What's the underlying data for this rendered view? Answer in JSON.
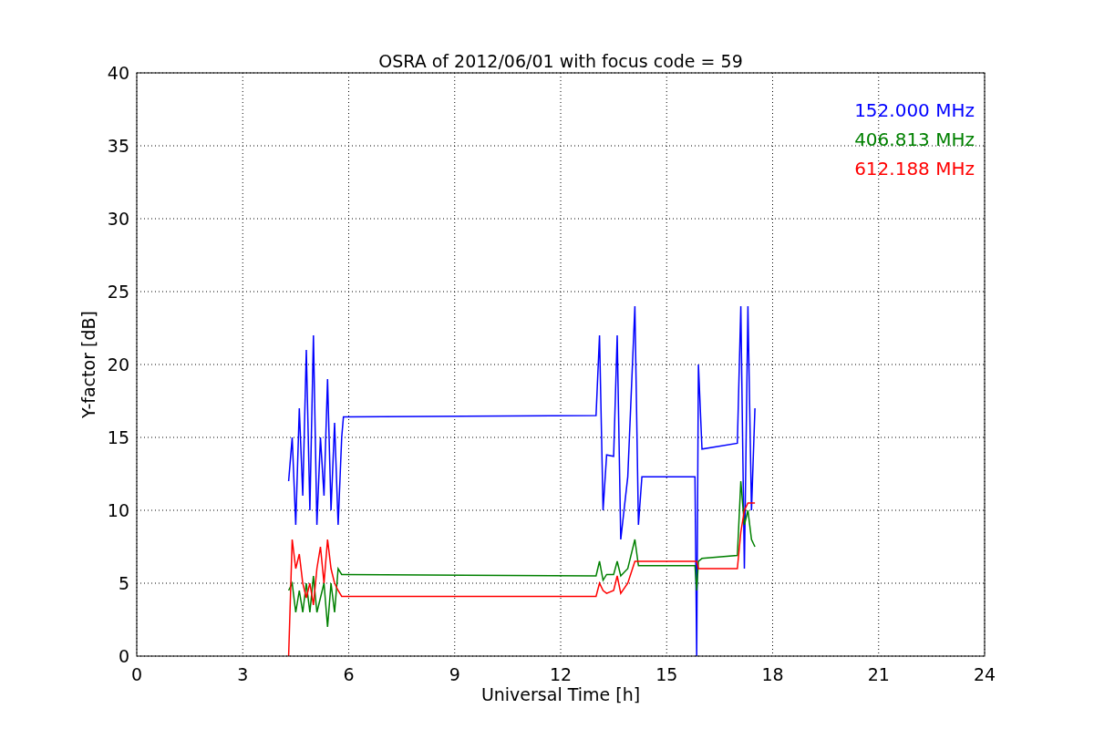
{
  "chart": {
    "chart_data": {
      "type": "line",
      "title": "OSRA of 2012/06/01 with focus code = 59",
      "xlabel": "Universal Time [h]",
      "ylabel": "Y-factor [dB]",
      "x": [
        4.3,
        4.4,
        4.5,
        4.6,
        4.7,
        4.8,
        4.9,
        5.0,
        5.1,
        5.2,
        5.3,
        5.4,
        5.5,
        5.6,
        5.7,
        5.8,
        5.85,
        13.0,
        13.1,
        13.2,
        13.3,
        13.5,
        13.6,
        13.7,
        13.9,
        14.1,
        14.2,
        14.3,
        15.8,
        15.85,
        15.9,
        16.0,
        17.0,
        17.1,
        17.2,
        17.3,
        17.4,
        17.5
      ],
      "series": [
        {
          "name": "152.000 MHz",
          "color": "#0000ff",
          "values": [
            12,
            15,
            9,
            17,
            11,
            21,
            10,
            22,
            9,
            15,
            11,
            19,
            10,
            16,
            9,
            15,
            16.4,
            16.5,
            22,
            10,
            13.8,
            13.7,
            22,
            8,
            12.3,
            24,
            9,
            12.3,
            12.3,
            0,
            20,
            14.2,
            14.6,
            24,
            6,
            24,
            10,
            17
          ]
        },
        {
          "name": "406.813 MHz",
          "color": "#008000",
          "values": [
            4.5,
            5,
            3,
            4.5,
            3,
            5,
            3,
            5.5,
            3,
            4,
            5,
            2,
            5,
            3,
            6,
            5.6,
            5.6,
            5.5,
            6.5,
            5.2,
            5.6,
            5.6,
            6.5,
            5.5,
            6,
            8,
            6.2,
            6.2,
            6.2,
            4.5,
            6.5,
            6.7,
            6.9,
            12,
            9,
            10,
            8,
            7.5
          ]
        },
        {
          "name": "612.188 MHz",
          "color": "#ff0000",
          "values": [
            0,
            8,
            6,
            7,
            5,
            4,
            5,
            3.5,
            6,
            7.5,
            5,
            8,
            6,
            5,
            4.5,
            4.1,
            4.1,
            4.1,
            5,
            4.5,
            4.3,
            4.5,
            5.5,
            4.3,
            5,
            6.5,
            6.5,
            6.5,
            6.5,
            6.5,
            6,
            6,
            6,
            8.5,
            10,
            10.5,
            10.5,
            10.5
          ]
        }
      ],
      "grid": true,
      "xlim": [
        0,
        24
      ],
      "ylim": [
        0,
        40
      ],
      "xticks": [
        0,
        3,
        6,
        9,
        12,
        15,
        18,
        21,
        24
      ],
      "yticks": [
        0,
        5,
        10,
        15,
        20,
        25,
        30,
        35,
        40
      ]
    }
  }
}
